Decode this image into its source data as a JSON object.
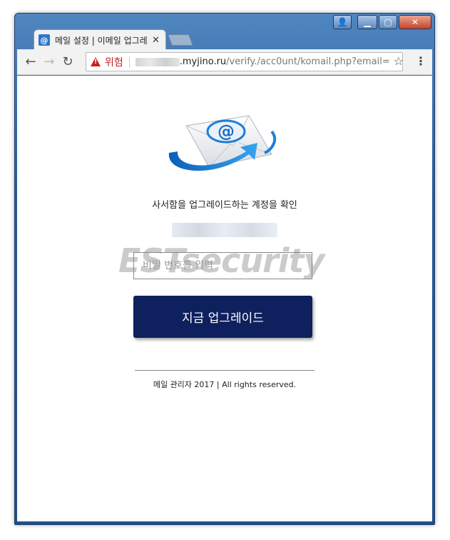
{
  "window": {
    "controls": {
      "user": "👤",
      "minimize": "▁",
      "maximize": "▢",
      "close": "✕"
    }
  },
  "tab": {
    "favicon": "@",
    "title": "메일 설정 | 이메일 업그레",
    "close": "✕"
  },
  "toolbar": {
    "back": "←",
    "forward": "→",
    "reload": "↻",
    "security_label": "위험",
    "url_domain": ".myjino.ru",
    "url_path": "/verify./acc0unt/komail.php?email=",
    "bookmark_icon": "☆",
    "menu_icon": "⋮"
  },
  "page": {
    "headline": "사서함을 업그레이드하는 계정을 확인",
    "watermark": "ESTsecurity",
    "password_placeholder": "비밀 번호를 입력",
    "submit_label": "지금 업그레이드",
    "footer": "메일 관리자 2017 | All rights reserved."
  },
  "colors": {
    "button": "#0f205e",
    "danger": "#c5221f",
    "logo_blue": "#1f7fd6"
  }
}
